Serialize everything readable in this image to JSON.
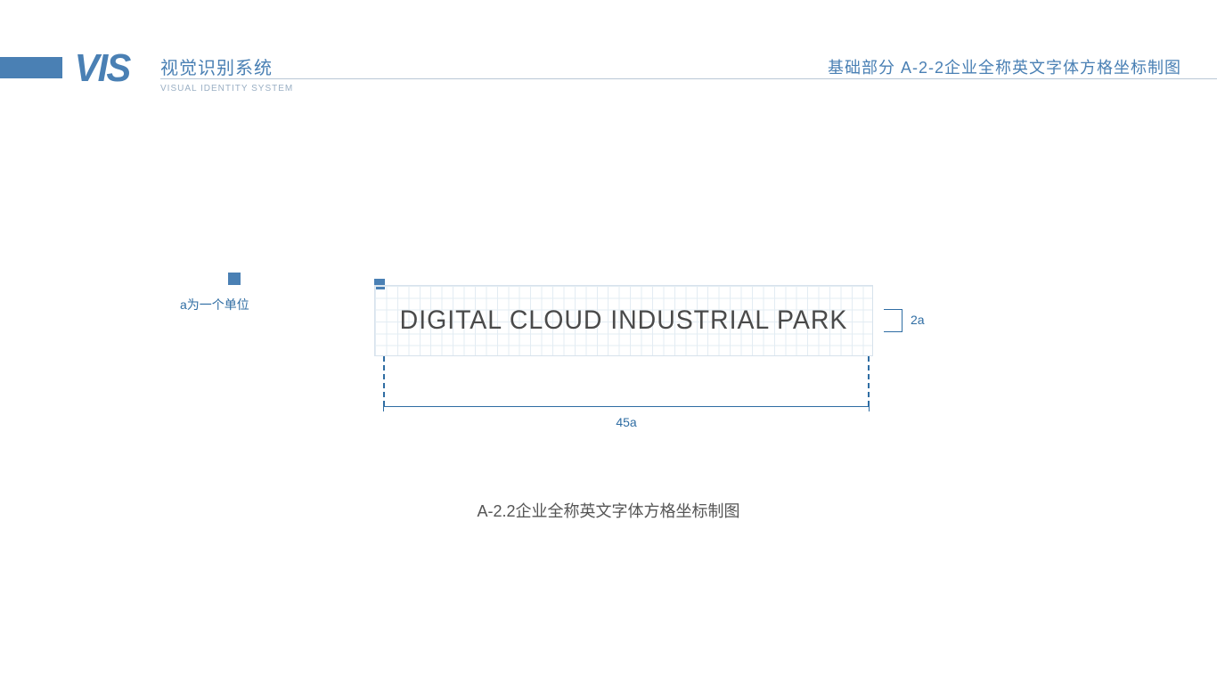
{
  "header": {
    "logo": "VIS",
    "title_cn": "视觉识别系统",
    "subtitle_en": "VISUAL IDENTITY SYSTEM",
    "right_text": "基础部分 A-2-2企业全称英文字体方格坐标制图"
  },
  "legend": {
    "unit_label": "a为一个单位"
  },
  "diagram": {
    "wordmark": "DIGITAL CLOUD INDUSTRIAL PARK",
    "height_label": "2a",
    "width_label": "45a"
  },
  "caption": "A-2.2企业全称英文字体方格坐标制图"
}
